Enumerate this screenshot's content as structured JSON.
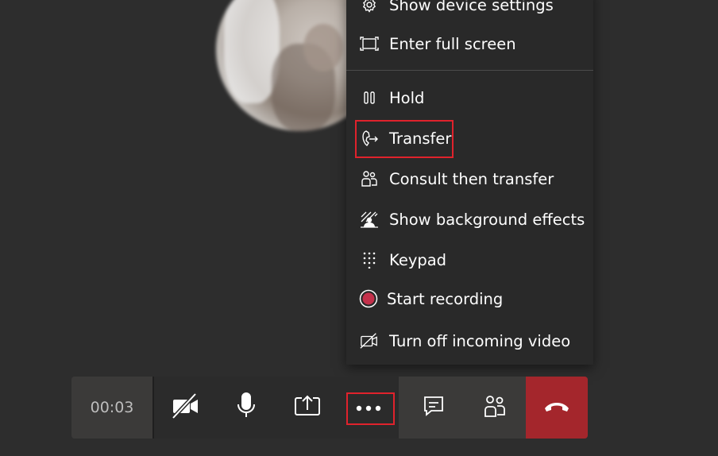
{
  "menu": {
    "items": [
      {
        "label": "Show device settings",
        "icon": "gear-icon"
      },
      {
        "label": "Enter full screen",
        "icon": "fullscreen-icon"
      },
      {
        "label": "Hold",
        "icon": "pause-icon"
      },
      {
        "label": "Transfer",
        "icon": "transfer-icon"
      },
      {
        "label": "Consult then transfer",
        "icon": "people-icon"
      },
      {
        "label": "Show background effects",
        "icon": "background-effects-icon"
      },
      {
        "label": "Keypad",
        "icon": "keypad-icon"
      },
      {
        "label": "Start recording",
        "icon": "record-icon"
      },
      {
        "label": "Turn off incoming video",
        "icon": "video-off-icon"
      }
    ]
  },
  "callbar": {
    "timer": "00:03",
    "buttons": [
      "camera-off-icon",
      "microphone-icon",
      "share-screen-icon",
      "more-options-icon",
      "chat-icon",
      "participants-icon",
      "hang-up-icon"
    ]
  },
  "colors": {
    "background": "#2d2d2d",
    "menu": "#292929",
    "highlight": "#e0222c",
    "hangup": "#a4262c",
    "record": "#c4314b"
  }
}
